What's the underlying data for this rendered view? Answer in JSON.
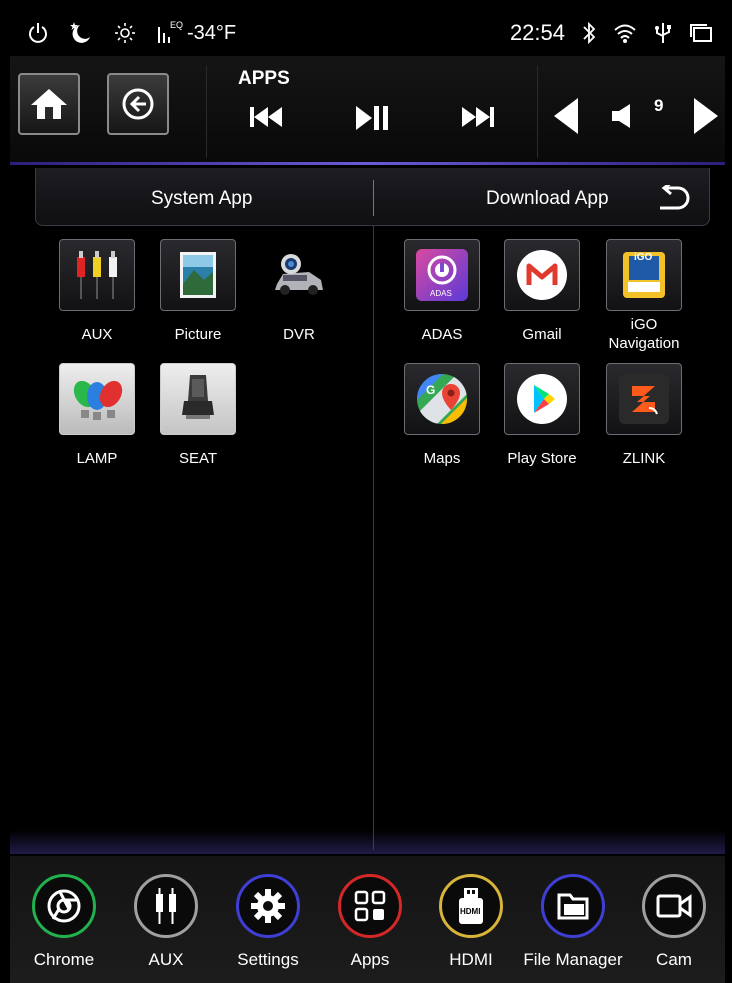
{
  "status_bar": {
    "icons": [
      "power-icon",
      "night-mode-icon",
      "brightness-icon",
      "equalizer-icon"
    ],
    "eq_label": "EQ",
    "temperature": "-34°F",
    "time": "22:54",
    "right_icons": [
      "bluetooth-icon",
      "wifi-icon",
      "usb-icon",
      "recent-apps-icon"
    ]
  },
  "topbar": {
    "title": "APPS",
    "volume": "9",
    "buttons": [
      "home-button",
      "back-button",
      "previous-track-button",
      "play-pause-button",
      "next-track-button",
      "volume-down-button",
      "volume-up-button"
    ]
  },
  "tabs": {
    "system": "System App",
    "download": "Download App"
  },
  "system_apps": [
    {
      "label": "AUX"
    },
    {
      "label": "Picture"
    },
    {
      "label": "DVR"
    },
    {
      "label": "LAMP"
    },
    {
      "label": "SEAT"
    }
  ],
  "download_apps": [
    {
      "label": "ADAS",
      "icon_text": "ADAS"
    },
    {
      "label": "Gmail"
    },
    {
      "label": "iGO\nNavigation",
      "icon_text": "iGO"
    },
    {
      "label": "Maps"
    },
    {
      "label": "Play Store"
    },
    {
      "label": "ZLINK"
    }
  ],
  "dock": [
    {
      "label": "Chrome",
      "color": "#22b14c"
    },
    {
      "label": "AUX",
      "color": "#a0a0a0"
    },
    {
      "label": "Settings",
      "color": "#3f3fd6"
    },
    {
      "label": "Apps",
      "color": "#d42828"
    },
    {
      "label": "HDMI",
      "color": "#d8b43a",
      "icon_text": "HDMI"
    },
    {
      "label": "File Manager",
      "color": "#3f3fd6"
    },
    {
      "label": "Cam",
      "color": "#a0a0a0"
    }
  ]
}
